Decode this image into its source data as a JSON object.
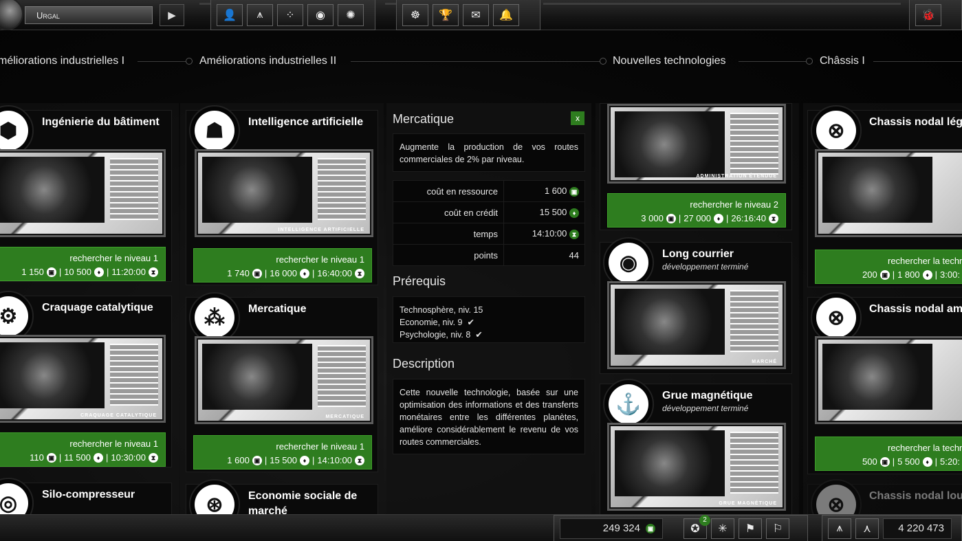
{
  "topbar": {
    "planet_name": "Urgal",
    "icons": {
      "send": "play-arrow-icon",
      "nav": [
        "person-icon",
        "fleet-icon",
        "galaxy-icon",
        "science-icon",
        "network-icon"
      ],
      "social": [
        "alliance-icon",
        "trophy-icon",
        "mail-icon",
        "bell-icon"
      ],
      "bug": "bug-icon"
    },
    "glyphs": {
      "send": "▶",
      "nav": [
        "👤",
        "⩚",
        "⁘",
        "◉",
        "✺"
      ],
      "social": [
        "☸",
        "🏆",
        "✉",
        "🔔"
      ],
      "bug": "🐞"
    }
  },
  "tree": {
    "labels": [
      "méliorations industrielles I",
      "Améliorations industrielles II",
      "Nouvelles technologies",
      "Châssis I"
    ]
  },
  "columns": {
    "col1": [
      {
        "title": "Ingénierie du bâtiment",
        "glyph": "⬢",
        "caption": "",
        "cta": "rechercher le niveau 1",
        "res": "1 150",
        "credit": "10 500",
        "time": "11:20:00"
      },
      {
        "title": "Craquage catalytique",
        "glyph": "⚙",
        "caption": "craquage catalytique",
        "cta": "rechercher le niveau 1",
        "res": "110",
        "credit": "11 500",
        "time": "10:30:00"
      },
      {
        "title": "Silo-compresseur",
        "glyph": "◎"
      }
    ],
    "col2": [
      {
        "title": "Intelligence artificielle",
        "glyph": "☗",
        "caption": "intelligence artificielle",
        "cta": "rechercher le niveau 1",
        "res": "1 740",
        "credit": "16 000",
        "time": "16:40:00"
      },
      {
        "title": "Mercatique",
        "glyph": "⁂",
        "caption": "mercatique",
        "cta": "rechercher le niveau 1",
        "res": "1 600",
        "credit": "15 500",
        "time": "14:10:00"
      },
      {
        "title": "Economie sociale de marché",
        "glyph": "⊛"
      }
    ],
    "col4": [
      {
        "caption": "administration étendue",
        "cta": "rechercher le niveau 2",
        "res": "3 000",
        "credit": "27 000",
        "time": "26:16:40"
      },
      {
        "title": "Long courrier",
        "sub": "développement terminé",
        "glyph": "◉",
        "caption": "marché"
      },
      {
        "title": "Grue magnétique",
        "sub": "développement terminé",
        "glyph": "⚓",
        "caption": "grue magnétique"
      }
    ],
    "col5": [
      {
        "title": "Chassis nodal lége",
        "glyph": "⊗",
        "cta": "rechercher la techn",
        "res": "200",
        "credit": "1 800",
        "time": "3:00:"
      },
      {
        "title": "Chassis nodal amé",
        "glyph": "⊗",
        "cta": "rechercher la techn",
        "res": "500",
        "credit": "5 500",
        "time": "5:20:"
      },
      {
        "title": "Chassis nodal lourd",
        "glyph": "⊗"
      }
    ]
  },
  "detail": {
    "title": "Mercatique",
    "close": "x",
    "summary": "Augmente la production de vos routes commerciales de 2% par niveau.",
    "stats": [
      {
        "label": "coût en ressource",
        "value": "1 600",
        "icon": "resource-icon"
      },
      {
        "label": "coût en crédit",
        "value": "15 500",
        "icon": "credit-icon"
      },
      {
        "label": "temps",
        "value": "14:10:00",
        "icon": "hourglass-icon"
      },
      {
        "label": "points",
        "value": "44",
        "icon": ""
      }
    ],
    "prereq_title": "Prérequis",
    "prereqs": [
      {
        "text": "Technosphère, niv. 15",
        "check": ""
      },
      {
        "text": "Economie, niv. 9",
        "check": "✔"
      },
      {
        "text": "Psychologie, niv. 8",
        "check": "✔"
      }
    ],
    "desc_title": "Description",
    "description": "Cette nouvelle technologie, basée sur une optimisation des informations et des transferts monétaires entre les différentes planètes, améliore considérablement le revenu de vos routes commerciales."
  },
  "bottombar": {
    "resources": "249 324",
    "badge_count": "2",
    "points": "4 220 473",
    "icons": [
      "resource-icon",
      "research-icon",
      "network-icon",
      "banner-icon",
      "banner-double-icon",
      "fleet-icon",
      "ships-icon"
    ],
    "glyphs": [
      "✪",
      "✳",
      "⚑",
      "⚐",
      "⩚",
      "⋏"
    ]
  },
  "colors": {
    "accent_green": "#2e7d1f",
    "bg": "#030303"
  }
}
